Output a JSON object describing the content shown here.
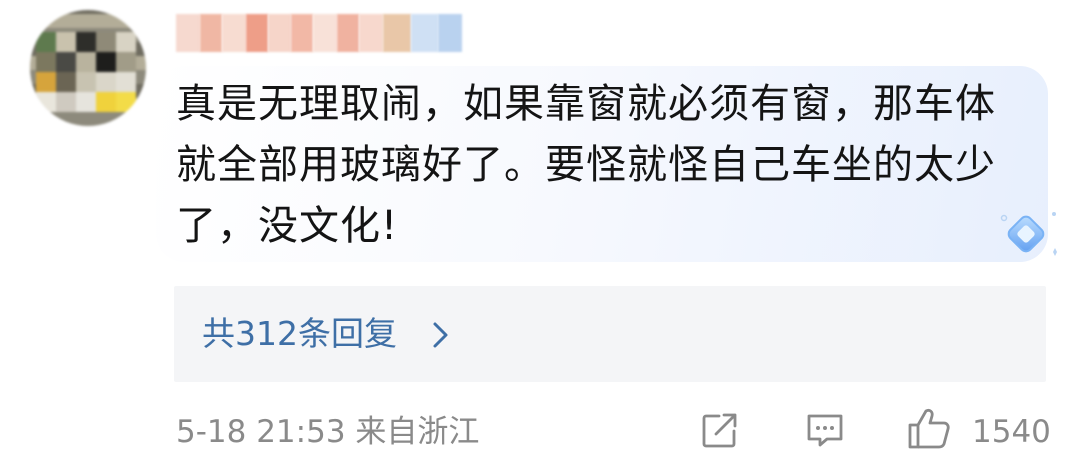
{
  "comment": {
    "text": "真是无理取闹，如果靠窗就必须有窗，那车体就全部用玻璃好了。要怪就怪自己车坐的太少了，没文化!"
  },
  "replies": {
    "label": "共312条回复"
  },
  "footer": {
    "timestamp_location": "5-18 21:53 来自浙江",
    "like_count": "1540"
  },
  "icons": {
    "share": "share-icon",
    "comment": "comment-icon",
    "like": "thumbs-up-icon",
    "chevron": "chevron-right-icon",
    "badge": "diamond-badge-icon"
  },
  "colors": {
    "reply_link": "#3e6fa6",
    "meta_gray": "#8a8a8a",
    "replies_bg": "#f4f5f7",
    "bubble_tint": "#e7effd"
  }
}
